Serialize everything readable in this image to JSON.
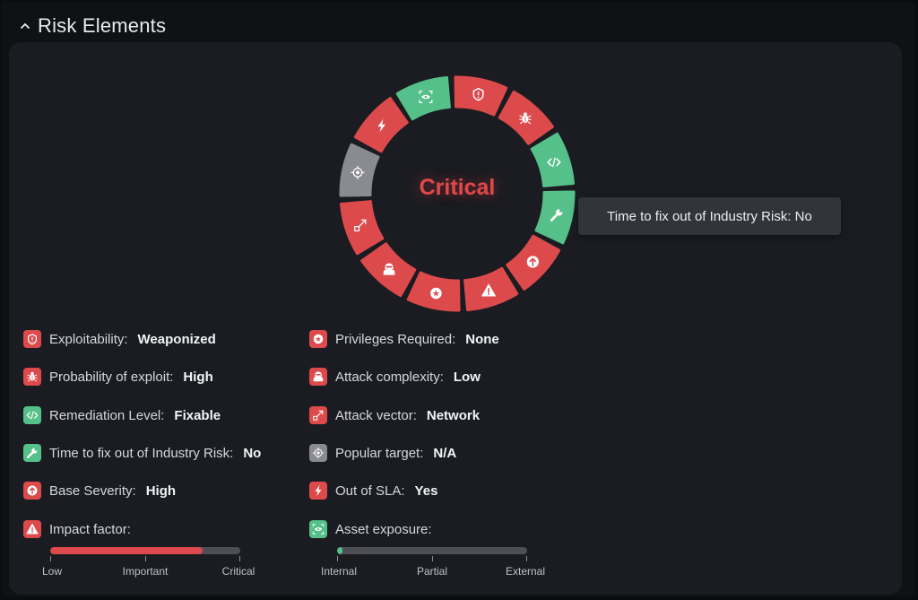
{
  "header": {
    "title": "Risk Elements",
    "chevron_icon": "chevron-up-icon"
  },
  "ring": {
    "center_label": "Critical",
    "center_color": "#e2474a",
    "segments": [
      {
        "name": "exploitability",
        "icon": "shield-alert-icon",
        "status": "red"
      },
      {
        "name": "probability",
        "icon": "bug-icon",
        "status": "red"
      },
      {
        "name": "remediation",
        "icon": "code-icon",
        "status": "green"
      },
      {
        "name": "time-to-fix",
        "icon": "wrench-icon",
        "status": "green"
      },
      {
        "name": "base-severity",
        "icon": "arrow-up-circle-icon",
        "status": "red"
      },
      {
        "name": "impact-factor",
        "icon": "warning-icon",
        "status": "red"
      },
      {
        "name": "privileges",
        "icon": "badge-icon",
        "status": "red"
      },
      {
        "name": "attack-complexity",
        "icon": "hacker-icon",
        "status": "red"
      },
      {
        "name": "attack-vector",
        "icon": "network-arrow-icon",
        "status": "red"
      },
      {
        "name": "popular-target",
        "icon": "target-icon",
        "status": "gray"
      },
      {
        "name": "out-of-sla",
        "icon": "lightning-icon",
        "status": "red"
      },
      {
        "name": "asset-exposure",
        "icon": "eye-scan-icon",
        "status": "green"
      }
    ]
  },
  "tooltip": {
    "text": "Time to fix out of Industry Risk: No"
  },
  "left_attributes": [
    {
      "label": "Exploitability:",
      "value": "Weaponized",
      "icon": "shield-alert-icon",
      "status": "red"
    },
    {
      "label": "Probability of exploit:",
      "value": "High",
      "icon": "bug-icon",
      "status": "red"
    },
    {
      "label": "Remediation Level:",
      "value": "Fixable",
      "icon": "code-icon",
      "status": "green"
    },
    {
      "label": "Time to fix out of Industry Risk:",
      "value": "No",
      "icon": "wrench-icon",
      "status": "green"
    },
    {
      "label": "Base Severity:",
      "value": "High",
      "icon": "arrow-up-circle-icon",
      "status": "red"
    },
    {
      "label": "Impact factor:",
      "value": "",
      "icon": "warning-icon",
      "status": "red"
    }
  ],
  "right_attributes": [
    {
      "label": "Privileges Required:",
      "value": "None",
      "icon": "badge-icon",
      "status": "red"
    },
    {
      "label": "Attack complexity:",
      "value": "Low",
      "icon": "hacker-icon",
      "status": "red"
    },
    {
      "label": "Attack vector:",
      "value": "Network",
      "icon": "network-arrow-icon",
      "status": "red"
    },
    {
      "label": "Popular target:",
      "value": "N/A",
      "icon": "target-icon",
      "status": "gray"
    },
    {
      "label": "Out of SLA:",
      "value": "Yes",
      "icon": "lightning-icon",
      "status": "red"
    },
    {
      "label": "Asset exposure:",
      "value": "",
      "icon": "eye-scan-icon",
      "status": "green"
    }
  ],
  "impact_scale": {
    "labels": [
      "Low",
      "Important",
      "Critical"
    ],
    "level": 0.8,
    "color": "#dd4a4c"
  },
  "exposure_scale": {
    "labels": [
      "Internal",
      "Partial",
      "External"
    ],
    "level": 0.03,
    "color": "#55c089"
  },
  "colors": {
    "red": "#dd4a4c",
    "green": "#55c089",
    "gray": "#8a8b90"
  }
}
